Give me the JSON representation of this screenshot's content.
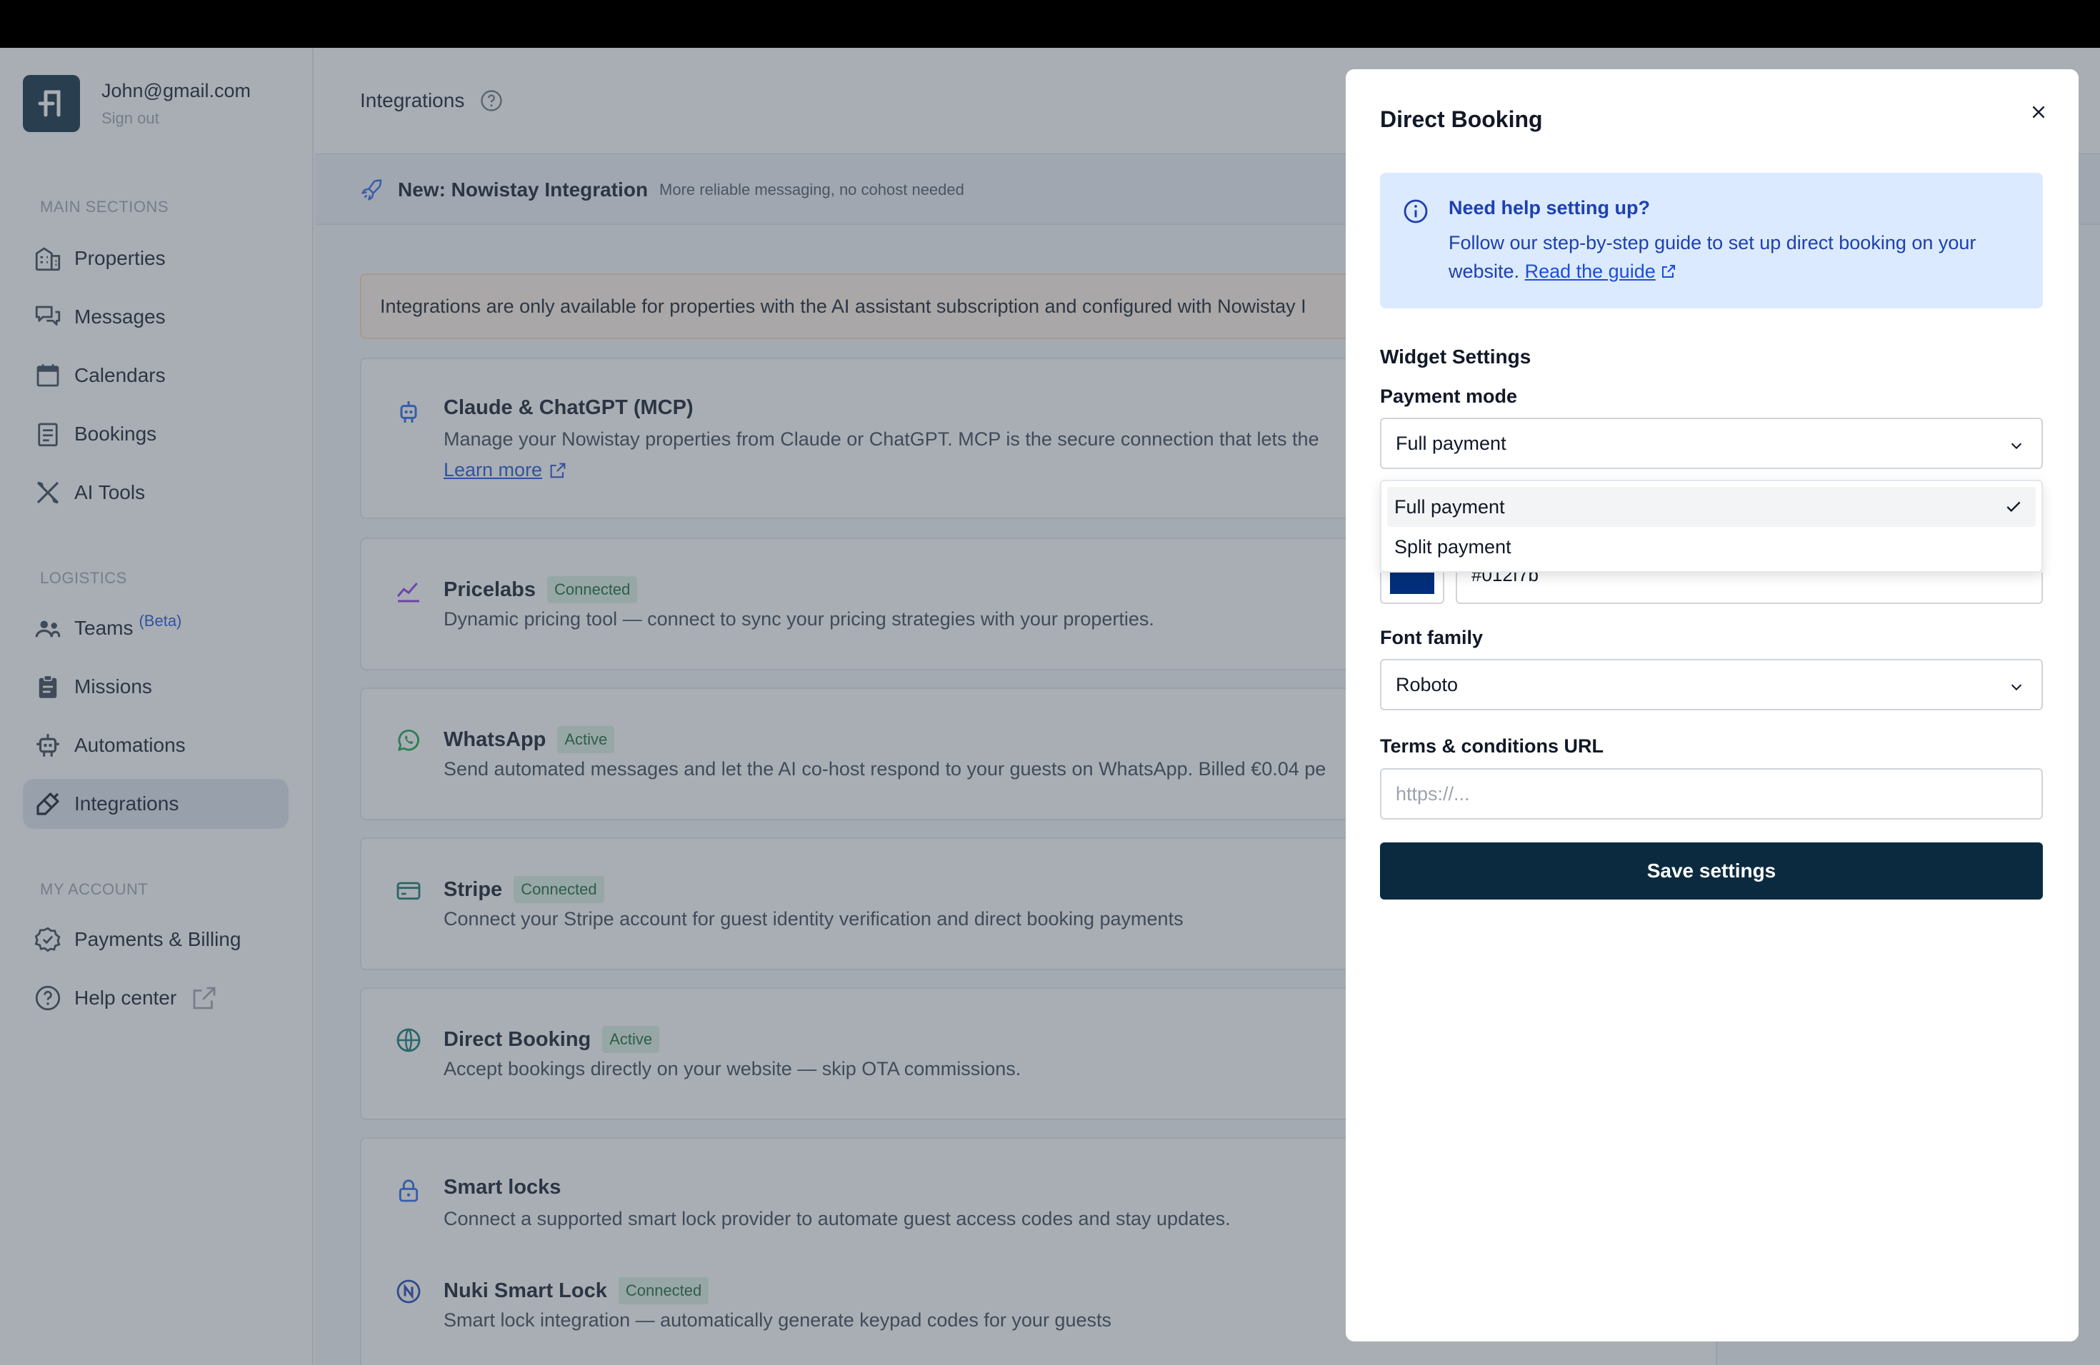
{
  "user": {
    "email": "John@gmail.com",
    "sign_out": "Sign out"
  },
  "sidebar": {
    "main_title": "MAIN SECTIONS",
    "main_items": [
      "Properties",
      "Messages",
      "Calendars",
      "Bookings",
      "AI Tools"
    ],
    "logistics_title": "LOGISTICS",
    "logistics_items": {
      "teams": "Teams",
      "teams_badge": "(Beta)",
      "missions": "Missions",
      "automations": "Automations",
      "integrations": "Integrations"
    },
    "account_title": "MY ACCOUNT",
    "account_items": [
      "Payments & Billing",
      "Help center"
    ]
  },
  "header": {
    "title": "Integrations"
  },
  "banner": {
    "title": "New: Nowistay Integration",
    "subtitle": "More reliable messaging, no cohost needed"
  },
  "warning": "Integrations are only available for properties with the AI assistant subscription and configured with Nowistay I",
  "integrations": [
    {
      "name": "Claude & ChatGPT (MCP)",
      "badge": "",
      "description": "Manage your Nowistay properties from Claude or ChatGPT. MCP is the secure connection that lets the",
      "link": "Learn more"
    },
    {
      "name": "Pricelabs",
      "badge": "Connected",
      "description": "Dynamic pricing tool — connect to sync your pricing strategies with your properties."
    },
    {
      "name": "WhatsApp",
      "badge": "Active",
      "description": "Send automated messages and let the AI co-host respond to your guests on WhatsApp. Billed €0.04 pe"
    },
    {
      "name": "Stripe",
      "badge": "Connected",
      "description": "Connect your Stripe account for guest identity verification and direct booking payments"
    },
    {
      "name": "Direct Booking",
      "badge": "Active",
      "description": "Accept bookings directly on your website — skip OTA commissions."
    },
    {
      "name": "Smart locks",
      "badge": "",
      "description": "Connect a supported smart lock provider to automate guest access codes and stay updates."
    },
    {
      "name": "Nuki Smart Lock",
      "badge": "Connected",
      "description": "Smart lock integration — automatically generate keypad codes for your guests"
    }
  ],
  "modal": {
    "title": "Direct Booking",
    "help": {
      "title": "Need help setting up?",
      "text": "Follow our step-by-step guide to set up direct booking on your website.",
      "link": "Read the guide"
    },
    "section": "Widget Settings",
    "payment_mode": {
      "label": "Payment mode",
      "value": "Full payment",
      "options": [
        "Full payment",
        "Split payment"
      ]
    },
    "primary_color": {
      "value": "#012f7b",
      "display": "#012f7b"
    },
    "font_family": {
      "label": "Font family",
      "value": "Roboto"
    },
    "terms": {
      "label": "Terms & conditions URL",
      "placeholder": "https://..."
    },
    "save": "Save settings"
  },
  "colors": {
    "accent": "#0b2a3f",
    "link": "#1d4ed8",
    "badge_bg": "#dcf1e4",
    "badge_text": "#166534"
  }
}
